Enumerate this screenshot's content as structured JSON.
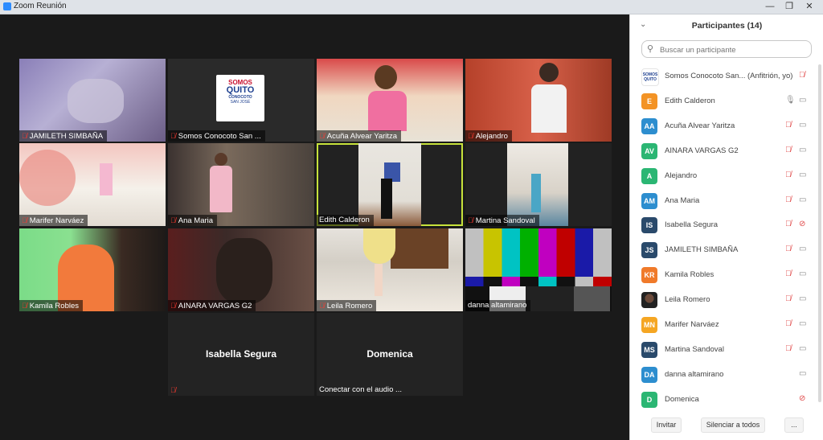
{
  "window": {
    "title": "Zoom Reunión",
    "controls": [
      "—",
      "❐",
      "✕"
    ]
  },
  "tiles": [
    {
      "name": "JAMILETH  SIMBAÑA",
      "muted": true
    },
    {
      "name": "Somos Conocoto San ...",
      "muted": true
    },
    {
      "name": "Acuña Alvear Yaritza",
      "muted": true
    },
    {
      "name": "Alejandro",
      "muted": true
    },
    {
      "name": "Marifer Narváez",
      "muted": true
    },
    {
      "name": "Ana Maria",
      "muted": true
    },
    {
      "name": "Edith Calderon",
      "muted": false
    },
    {
      "name": "Martina Sandoval",
      "muted": true
    },
    {
      "name": "Kamila Robles",
      "muted": true
    },
    {
      "name": "AINARA VARGAS    G2",
      "muted": true
    },
    {
      "name": "Leila Romero",
      "muted": true
    },
    {
      "name": "danna altamirano",
      "muted": false
    },
    {
      "name": "Isabella Segura",
      "muted": true
    },
    {
      "name": "Domenica",
      "muted": false,
      "caption": "Conectar con el audio ..."
    }
  ],
  "logo": {
    "line1": "SOMOS",
    "line2": "QUITO",
    "line3": "CONOCOTO",
    "line4": "SAN JOSÉ"
  },
  "panel": {
    "title": "Participantes (14)",
    "search_placeholder": "Buscar un participante",
    "participants": [
      {
        "initials": "",
        "name": "Somos Conocoto San...  (Anfitrión, yo)",
        "color": "#ffffff",
        "mic": "muted",
        "cam": ""
      },
      {
        "initials": "E",
        "name": "Edith Calderon",
        "color": "#f39325",
        "mic": "on",
        "cam": "on"
      },
      {
        "initials": "AA",
        "name": "Acuña Alvear Yaritza",
        "color": "#2d8ecf",
        "mic": "muted",
        "cam": "on"
      },
      {
        "initials": "AV",
        "name": "AINARA VARGAS    G2",
        "color": "#2bb673",
        "mic": "muted",
        "cam": "on"
      },
      {
        "initials": "A",
        "name": "Alejandro",
        "color": "#2bb673",
        "mic": "muted",
        "cam": "on"
      },
      {
        "initials": "AM",
        "name": "Ana Maria",
        "color": "#2d8ecf",
        "mic": "muted",
        "cam": "on"
      },
      {
        "initials": "IS",
        "name": "Isabella Segura",
        "color": "#2a4a6b",
        "mic": "muted",
        "cam": "off"
      },
      {
        "initials": "JS",
        "name": "JAMILETH  SIMBAÑA",
        "color": "#2a4a6b",
        "mic": "muted",
        "cam": "on"
      },
      {
        "initials": "KR",
        "name": "Kamila Robles",
        "color": "#f07a2a",
        "mic": "muted",
        "cam": "on"
      },
      {
        "initials": "",
        "name": "Leila Romero",
        "color": "#3b3b3b",
        "mic": "muted",
        "cam": "on"
      },
      {
        "initials": "MN",
        "name": "Marifer Narváez",
        "color": "#f5a623",
        "mic": "muted",
        "cam": "on"
      },
      {
        "initials": "MS",
        "name": "Martina Sandoval",
        "color": "#2a4a6b",
        "mic": "muted",
        "cam": "on"
      },
      {
        "initials": "DA",
        "name": "danna altamirano",
        "color": "#2d8ecf",
        "mic": "",
        "cam": "on"
      },
      {
        "initials": "D",
        "name": "Domenica",
        "color": "#2bb673",
        "mic": "",
        "cam": "off"
      }
    ],
    "footer": {
      "invite": "Invitar",
      "mute_all": "Silenciar a todos",
      "more": "..."
    }
  },
  "colors": {
    "muted": "#e04848",
    "active_speaker": "#c7e23b"
  },
  "icons": {
    "mic_muted": "mic-muted-icon",
    "mic_on": "mic-icon",
    "cam_on": "camera-icon",
    "cam_off": "camera-off-icon"
  }
}
